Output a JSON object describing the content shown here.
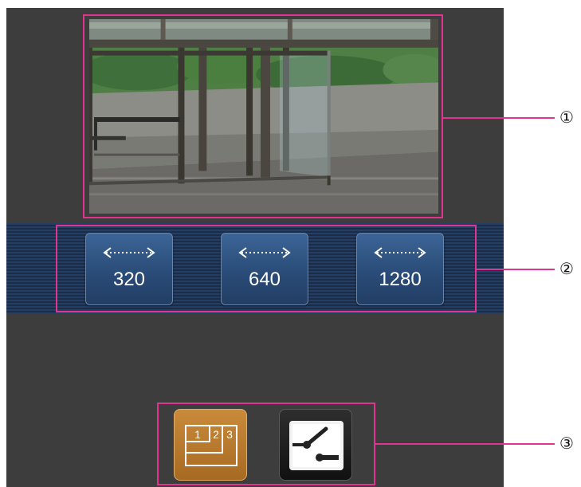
{
  "resolution_buttons": [
    {
      "label": "320"
    },
    {
      "label": "640"
    },
    {
      "label": "1280"
    }
  ],
  "bottom_buttons": {
    "multi_screen": {
      "digits": [
        "1",
        "2",
        "3"
      ]
    },
    "ptz": {
      "icon": "pan-tilt-icon"
    }
  },
  "callouts": [
    "①",
    "②",
    "③"
  ],
  "colors": {
    "callout_pink": "#e0358f",
    "screen_bg": "#3d3d3d",
    "strip_blue": "#253e63",
    "button_blue": "#2a4c78",
    "multi_orange": "#b8782e"
  }
}
